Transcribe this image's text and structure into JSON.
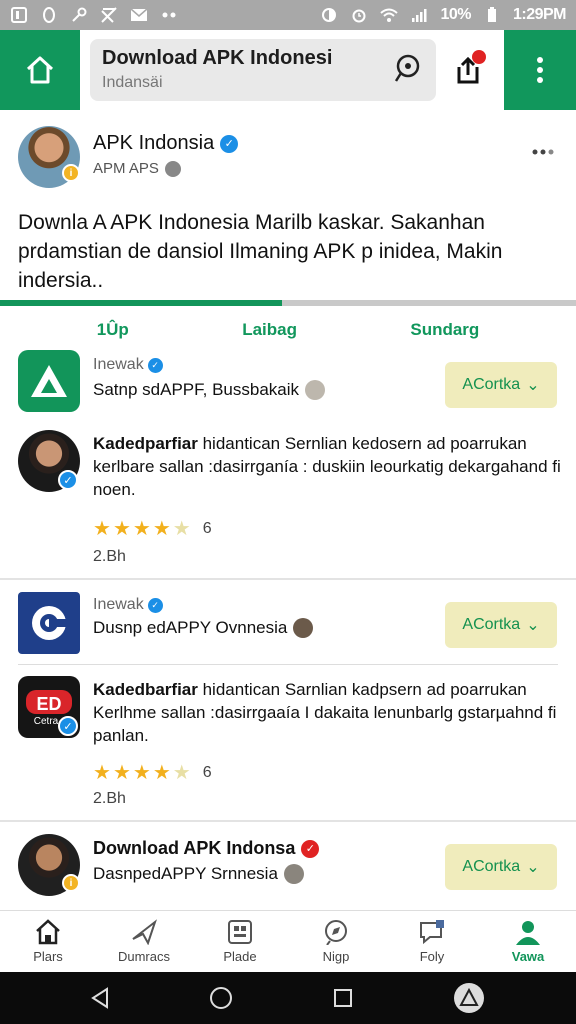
{
  "status_bar": {
    "battery": "10%",
    "time": "1:29PM"
  },
  "app_bar": {
    "title": "Download APK Indonesi",
    "subtitle": "Indansäi"
  },
  "profile": {
    "name": "APK Indonsia",
    "handle": "APM APS",
    "description": "Downla A APK Indonesia Marilb kaskar. Sakanhan prdamstian de dansiol Ilmaning APK p inidea, Makin indersia.."
  },
  "tabs": [
    "1Ûp",
    "Laibag",
    "Sundarg"
  ],
  "items": [
    {
      "publisher": "Inewak",
      "desc": "Satnp sdAPPF, Bussbakaik",
      "button": "ACortka"
    },
    {
      "publisher": "Inewak",
      "desc": "Dusnp edAPPY Ovnnesia",
      "button": "ACortka"
    },
    {
      "publisher": "Download APK Indonsa",
      "desc": "DasnpedAPPY Srnnesia",
      "button": "ACortka"
    }
  ],
  "reviews": [
    {
      "lead": "Kadedparfiar",
      "text": " hidantican Sernlian kedosern ad poarrukan kerlbare sallan :dasirrganía : duskiin leourkatig dekargahand fi noen.",
      "rating": 4.5,
      "count": "6",
      "sub": "2.Bh"
    },
    {
      "lead": "Kadedbarfiar",
      "text": " hidantican Sarnlian kadpsern ad poarrukan Kerlhme sallan :dasirrgaaía I dakaita lenunbarlg gstarµahnd fi panlan.",
      "rating": 4.5,
      "count": "6",
      "sub": "2.Bh"
    }
  ],
  "bottom_nav": [
    "Plars",
    "Dumracs",
    "Plade",
    "Nigp",
    "Foly",
    "Vawa"
  ],
  "colors": {
    "brand_green": "#11975c",
    "button_bg": "#f0ecbc",
    "star": "#f2b01d"
  }
}
